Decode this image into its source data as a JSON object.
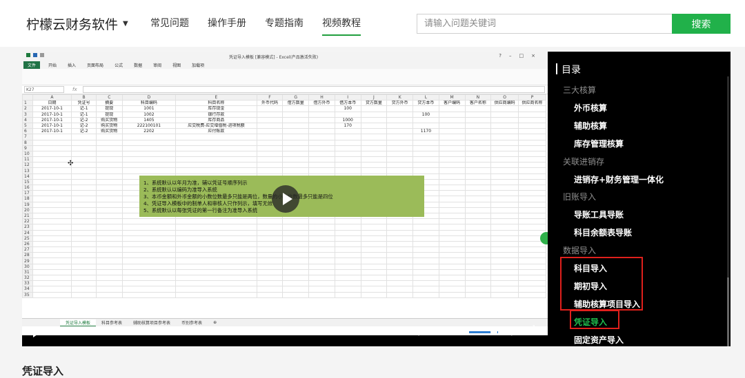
{
  "header": {
    "brand": "柠檬云财务软件",
    "nav": [
      "常见问题",
      "操作手册",
      "专题指南",
      "视频教程"
    ],
    "search_placeholder": "请输入问题关键词",
    "search_button": "搜索"
  },
  "excel": {
    "window_title": "凭证导入模板 [兼容模式] - Excel(产品激活失败)",
    "ribbon_tabs": [
      "文件",
      "开始",
      "插入",
      "页面布局",
      "公式",
      "数据",
      "审阅",
      "视图",
      "加载项"
    ],
    "cell_ref": "K27",
    "columns": [
      "",
      "A",
      "B",
      "C",
      "D",
      "E",
      "F",
      "G",
      "H",
      "I",
      "J",
      "K",
      "L",
      "M",
      "N",
      "O",
      "P"
    ],
    "header_row": [
      "1",
      "日期",
      "凭证号",
      "摘要",
      "科目编码",
      "科目名称",
      "外币代码",
      "借方数量",
      "借方外币",
      "借方本币",
      "贷方数量",
      "贷方外币",
      "贷方本币",
      "客户编码",
      "客户名称",
      "供应商编码",
      "供应商名称"
    ],
    "rows": [
      [
        "2",
        "2017-10-1",
        "记-1",
        "提现",
        "1001",
        "库存现金",
        "",
        "",
        "",
        "100",
        "",
        "",
        "",
        "",
        "",
        "",
        ""
      ],
      [
        "3",
        "2017-10-1",
        "记-1",
        "提现",
        "1002",
        "银行存款",
        "",
        "",
        "",
        "",
        "",
        "",
        "100",
        "",
        "",
        "",
        ""
      ],
      [
        "4",
        "2017-10-1",
        "记-2",
        "购买货物",
        "1405",
        "库存商品",
        "",
        "",
        "",
        "1000",
        "",
        "",
        "",
        "",
        "",
        "",
        ""
      ],
      [
        "5",
        "2017-10-1",
        "记-2",
        "购买货物",
        "222100101",
        "应交税费-应交增值税-进项税额",
        "",
        "",
        "",
        "170",
        "",
        "",
        "",
        "",
        "",
        "",
        ""
      ],
      [
        "6",
        "2017-10-1",
        "记-2",
        "购买货物",
        "2202",
        "应付账款",
        "",
        "",
        "",
        "",
        "",
        "",
        "1170",
        "",
        "",
        "",
        ""
      ]
    ],
    "empty_row_numbers": [
      "7",
      "8",
      "9",
      "10",
      "11",
      "12",
      "13",
      "14",
      "15",
      "16",
      "17",
      "18",
      "19",
      "20",
      "21",
      "22",
      "23",
      "24",
      "25",
      "26",
      "27",
      "28",
      "29",
      "30",
      "31",
      "32",
      "33",
      "34",
      "35"
    ],
    "sheet_tabs": [
      "凭证导入模板",
      "科目参考表",
      "辅助核算项目参考表",
      "币别参考表"
    ],
    "notes": [
      "1、系统默认以年月为准，辅以凭证号顺序列示",
      "2、系统默认以编码为准导入系统",
      "3、本币金额和外币金额的小数位数最多只能是两位，数量的小数位数最多只能是四位",
      "4、凭证导入模板中的制单人和审核人只作列示，填写无效",
      "5、系统默认以每张凭证的第一行备注为准导入系统"
    ]
  },
  "player": {
    "current_time": "00:00",
    "separator": "/",
    "duration": "05:31",
    "progress": 0,
    "volume": 0.85
  },
  "toc": {
    "title": "目录",
    "items": [
      {
        "label": "三大核算",
        "type": "category"
      },
      {
        "label": "外币核算",
        "type": "item"
      },
      {
        "label": "辅助核算",
        "type": "item"
      },
      {
        "label": "库存管理核算",
        "type": "item"
      },
      {
        "label": "关联进销存",
        "type": "category"
      },
      {
        "label": "进销存+财务管理一体化",
        "type": "item"
      },
      {
        "label": "旧账导入",
        "type": "category"
      },
      {
        "label": "导账工具导账",
        "type": "item"
      },
      {
        "label": "科目余额表导账",
        "type": "item"
      },
      {
        "label": "数据导入",
        "type": "category"
      },
      {
        "label": "科目导入",
        "type": "item"
      },
      {
        "label": "期初导入",
        "type": "item"
      },
      {
        "label": "辅助核算项目导入",
        "type": "item"
      },
      {
        "label": "凭证导入",
        "type": "active"
      },
      {
        "label": "固定资产导入",
        "type": "item"
      }
    ]
  },
  "page": {
    "section_title": "凭证导入"
  },
  "colors": {
    "accent": "#21b14a",
    "active_toc": "#1fbf4e",
    "highlight_box": "#e0201c",
    "note_bg": "#9bbb59"
  }
}
